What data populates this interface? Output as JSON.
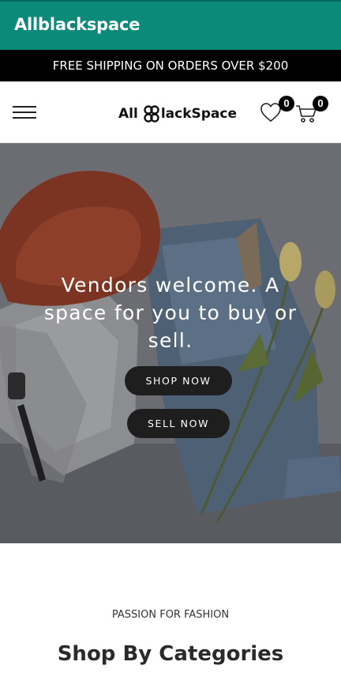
{
  "app": {
    "title": "Allblackspace"
  },
  "promo": {
    "text": "FREE SHIPPING ON ORDERS OVER $200"
  },
  "header": {
    "logo_left": "All",
    "logo_right": "lackSpace",
    "wishlist_count": "0",
    "cart_count": "0",
    "icons": [
      "menu-icon",
      "heart-icon",
      "cart-icon"
    ]
  },
  "hero": {
    "title": "Vendors welcome. A space for you to buy or sell.",
    "shop_label": "SHOP NOW",
    "sell_label": "SELL NOW"
  },
  "section": {
    "eyebrow": "PASSION FOR FASHION",
    "title": "Shop By Categories"
  },
  "colors": {
    "appbar": "#0b8a7a",
    "promo_bg": "#000000",
    "button_bg": "#1e1e1e"
  }
}
